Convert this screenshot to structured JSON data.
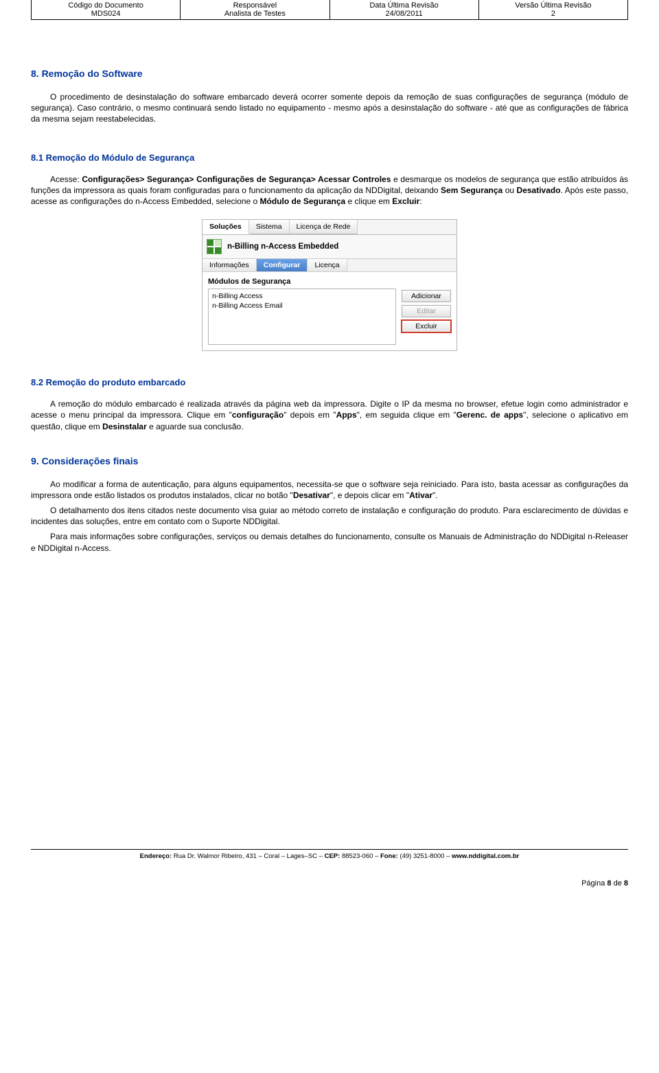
{
  "header": {
    "cols": [
      {
        "label": "Código do Documento",
        "value": "MDS024"
      },
      {
        "label": "Responsável",
        "value": "Analista de Testes"
      },
      {
        "label": "Data Última Revisão",
        "value": "24/08/2011"
      },
      {
        "label": "Versão Última Revisão",
        "value": "2"
      }
    ]
  },
  "s8": {
    "title": "8.  Remoção do Software",
    "para": "O procedimento de desinstalação do software embarcado deverá ocorrer somente depois da remoção de suas configurações de segurança (módulo de segurança). Caso contrário, o mesmo continuará sendo listado no equipamento - mesmo após a desinstalação do software - até que as configurações de fábrica da mesma sejam reestabelecidas."
  },
  "s81": {
    "title": "8.1 Remoção do Módulo de Segurança",
    "p1a": "Acesse: ",
    "p1b": "Configurações> Segurança> Configurações de Segurança> Acessar Controles",
    "p1c": " e desmarque os modelos de segurança que estão atribuídos às funções da impressora as quais foram configuradas para o funcionamento da aplicação da NDDigital, deixando ",
    "p1d": "Sem Segurança",
    "p1e": " ou ",
    "p1f": "Desativado",
    "p1g": ". Após este passo, acesse as configurações do n-Access Embedded, selecione o ",
    "p1h": "Módulo de Segurança",
    "p1i": " e clique em ",
    "p1j": "Excluir",
    "p1k": ":"
  },
  "fig": {
    "toptabs": {
      "t1": "Soluções",
      "t2": "Sistema",
      "t3": "Licença de Rede"
    },
    "title": "n-Billing n-Access Embedded",
    "subtabs": {
      "t1": "Informações",
      "t2": "Configurar",
      "t3": "Licença"
    },
    "modsLabel": "Módulos de Segurança",
    "modsList": [
      "n-Billing Access",
      "n-Billing Access Email"
    ],
    "btnAdd": "Adicionar",
    "btnEdit": "Editar",
    "btnDel": "Excluir"
  },
  "s82": {
    "title": "8.2 Remoção do produto embarcado",
    "a": "A remoção do módulo embarcado é realizada através da página web da impressora. Digite o IP da mesma no browser, efetue login como administrador e acesse o menu principal da impressora. Clique em \"",
    "b": "configuração",
    "c": "\" depois em \"",
    "d": "Apps",
    "e": "\", em seguida clique em \"",
    "f": "Gerenc. de apps",
    "g": "\", selecione o aplicativo em questão, clique em ",
    "h": "Desinstalar",
    "i": " e aguarde sua conclusão."
  },
  "s9": {
    "title": "9.    Considerações finais",
    "p1a": "Ao modificar a forma de autenticação, para alguns equipamentos, necessita-se que o software seja reiniciado. Para isto, basta acessar as configurações da impressora onde estão listados os produtos instalados, clicar no botão \"",
    "p1b": "Desativar",
    "p1c": "\", e depois clicar em \"",
    "p1d": "Ativar",
    "p1e": "\".",
    "p2": "O detalhamento dos itens citados neste documento visa guiar ao método correto de instalação e configuração do produto. Para esclarecimento de dúvidas e incidentes das soluções, entre em contato com o Suporte NDDigital.",
    "p3": "Para mais informações sobre configurações, serviços ou demais detalhes do funcionamento, consulte os Manuais de Administração do NDDigital n-Releaser e NDDigital n-Access."
  },
  "footer": {
    "labelEndereco": "Endereço:",
    "endereco": " Rua Dr. Walmor Ribeiro, 431 – Coral – Lages–SC – ",
    "labelCEP": "CEP:",
    "cep": " 88523-060 – ",
    "labelFone": "Fone:",
    "fone": " (49) 3251-8000 – ",
    "site": "www.nddigital.com.br"
  },
  "pagenum": {
    "label": "Página ",
    "cur": "8",
    "of": " de ",
    "total": "8"
  }
}
